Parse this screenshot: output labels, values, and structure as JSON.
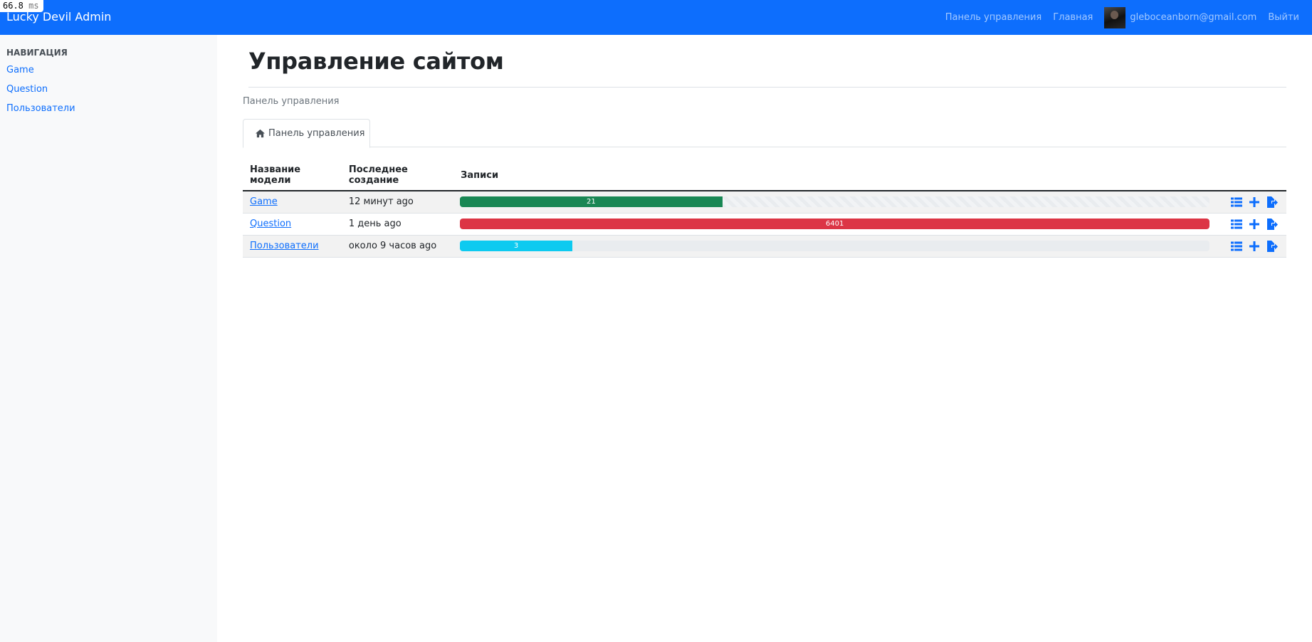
{
  "timing": {
    "value": "66.8",
    "unit": "ms"
  },
  "navbar": {
    "brand": "Lucky Devil Admin",
    "links": [
      "Панель управления",
      "Главная"
    ],
    "user_email": "gleboceanborn@gmail.com",
    "logout": "Выйти"
  },
  "sidebar": {
    "heading": "НАВИГАЦИЯ",
    "items": [
      "Game",
      "Question",
      "Пользователи"
    ]
  },
  "main": {
    "title": "Управление сайтом",
    "breadcrumb": "Панель управления",
    "tab_label": "Панель управления"
  },
  "table": {
    "headers": [
      "Название модели",
      "Последнее создание",
      "Записи"
    ],
    "rows": [
      {
        "name": "Game",
        "last_created": "12 минут ago",
        "count": "21",
        "fill_fraction": 0.35,
        "color": "#198754",
        "striped": true
      },
      {
        "name": "Question",
        "last_created": "1 день ago",
        "count": "6401",
        "fill_fraction": 1.0,
        "color": "#dc3545",
        "striped": false
      },
      {
        "name": "Пользователи",
        "last_created": "около 9 часов ago",
        "count": "3",
        "fill_fraction": 0.15,
        "color": "#0dcaf0",
        "striped": false
      }
    ],
    "row_actions": [
      "list-icon",
      "plus-icon",
      "file-export-icon"
    ]
  },
  "colors": {
    "primary": "#0d6efd",
    "sidebar_bg": "#f8f9fa"
  }
}
